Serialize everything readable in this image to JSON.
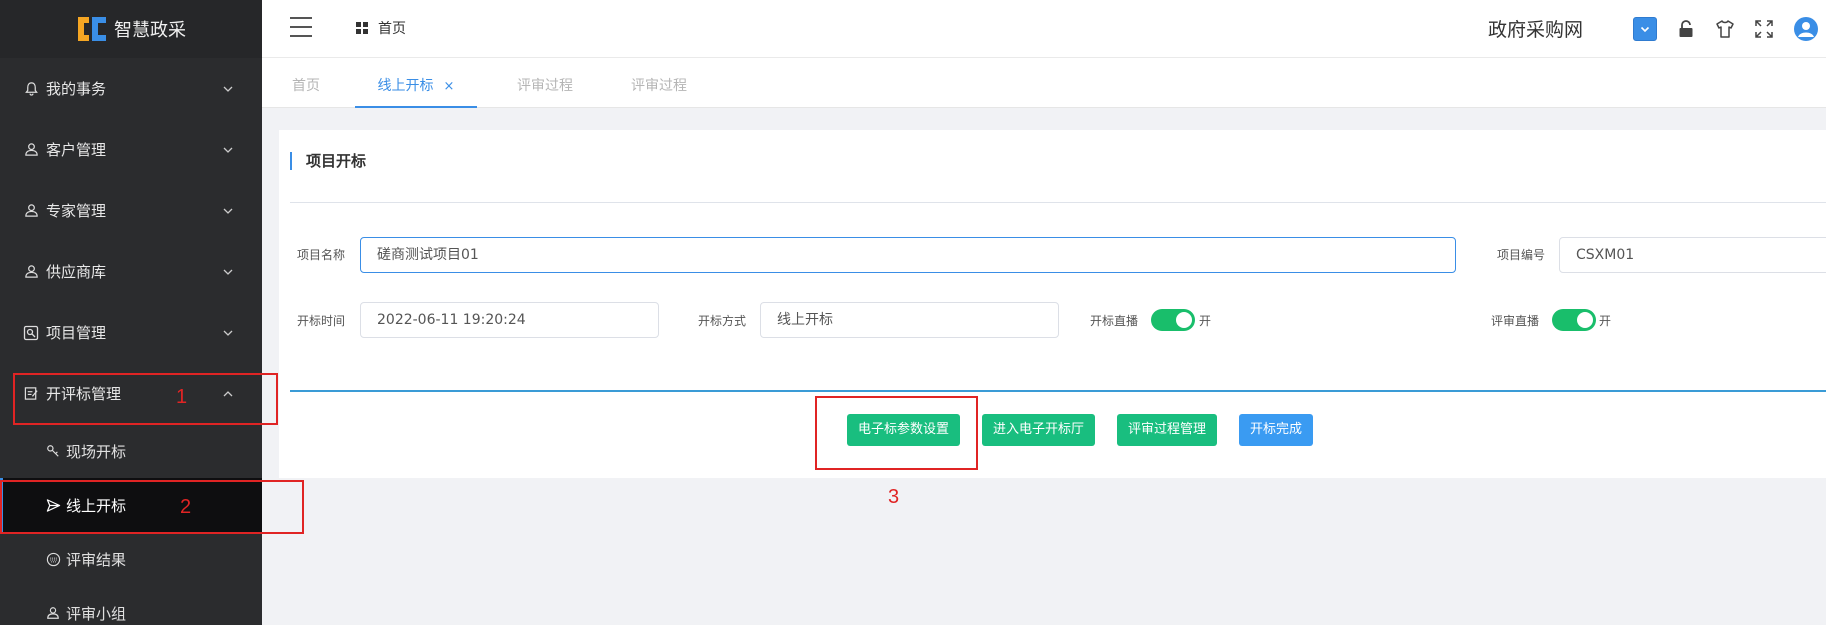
{
  "app": {
    "logo_text": "智慧政采",
    "site_title": "政府采购网"
  },
  "sidebar": {
    "items": [
      {
        "label": "我的事务",
        "icon": "bell-icon"
      },
      {
        "label": "客户管理",
        "icon": "user-icon"
      },
      {
        "label": "专家管理",
        "icon": "user-icon"
      },
      {
        "label": "供应商库",
        "icon": "user-icon"
      },
      {
        "label": "项目管理",
        "icon": "project-icon"
      },
      {
        "label": "开评标管理",
        "icon": "edit-icon"
      }
    ],
    "sub_items": [
      {
        "label": "现场开标",
        "icon": "key-icon"
      },
      {
        "label": "线上开标",
        "icon": "send-icon"
      },
      {
        "label": "评审结果",
        "icon": "keyboard-icon"
      },
      {
        "label": "评审小组",
        "icon": "user-icon"
      }
    ]
  },
  "header": {
    "breadcrumb": "首页"
  },
  "tabs": [
    {
      "label": "首页"
    },
    {
      "label": "线上开标",
      "close": "×"
    },
    {
      "label": "评审过程"
    },
    {
      "label": "评审过程"
    }
  ],
  "form": {
    "section_title": "项目开标",
    "project_name_label": "项目名称",
    "project_name_value": "磋商测试项目01",
    "project_code_label": "项目编号",
    "project_code_value": "CSXM01",
    "open_time_label": "开标时间",
    "open_time_value": "2022-06-11 19:20:24",
    "open_method_label": "开标方式",
    "open_method_value": "线上开标",
    "live_open_label": "开标直播",
    "live_open_state": "开",
    "live_review_label": "评审直播",
    "live_review_state": "开"
  },
  "buttons": {
    "param_settings": "电子标参数设置",
    "enter_hall": "进入电子开标厅",
    "review_manage": "评审过程管理",
    "finish": "开标完成"
  },
  "annotations": {
    "one": "1",
    "two": "2",
    "three": "3"
  },
  "colors": {
    "accent": "#3a8ee6",
    "green": "#19be7f",
    "annotation": "#e02424",
    "sidebar_bg": "#2b2c2e"
  }
}
